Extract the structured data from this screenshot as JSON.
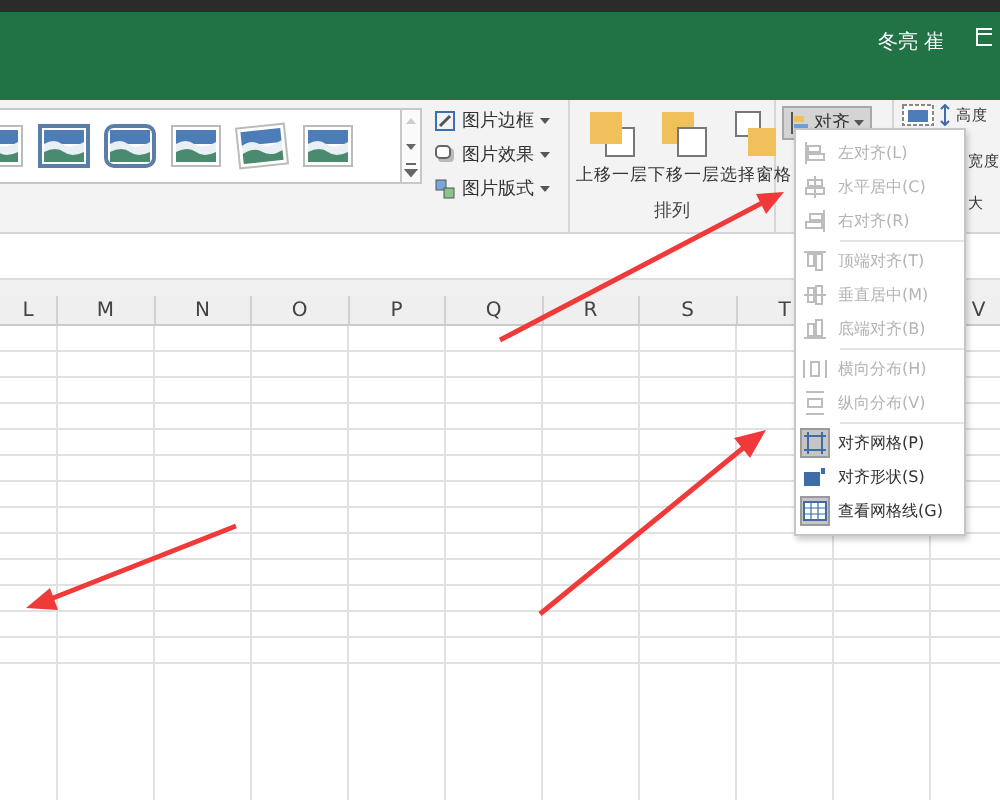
{
  "account": {
    "user_name": "冬亮 崔"
  },
  "ribbon": {
    "picture_commands": [
      {
        "label": "图片边框"
      },
      {
        "label": "图片效果"
      },
      {
        "label": "图片版式"
      }
    ],
    "arrange": {
      "buttons": [
        {
          "label": "上移一层",
          "kind": "forward"
        },
        {
          "label": "下移一层",
          "kind": "backward"
        },
        {
          "label": "选择窗格",
          "kind": "pane"
        }
      ],
      "align_button": {
        "label": "对齐",
        "expanded": true
      },
      "group_label": "排列"
    },
    "size": {
      "height_label": "高度",
      "width_label": "宽度",
      "group_label": "大"
    }
  },
  "align_menu": {
    "items": [
      {
        "label": "左对齐(L)",
        "kind": "left",
        "disabled": true,
        "checked": false
      },
      {
        "label": "水平居中(C)",
        "kind": "center",
        "disabled": true,
        "checked": false
      },
      {
        "label": "右对齐(R)",
        "kind": "right",
        "disabled": true,
        "checked": false,
        "separator_after": true
      },
      {
        "label": "顶端对齐(T)",
        "kind": "top",
        "disabled": true,
        "checked": false
      },
      {
        "label": "垂直居中(M)",
        "kind": "middle",
        "disabled": true,
        "checked": false
      },
      {
        "label": "底端对齐(B)",
        "kind": "bottom",
        "disabled": true,
        "checked": false,
        "separator_after": true
      },
      {
        "label": "横向分布(H)",
        "kind": "hdist",
        "disabled": true,
        "checked": false
      },
      {
        "label": "纵向分布(V)",
        "kind": "vdist",
        "disabled": true,
        "checked": false,
        "separator_after": true
      },
      {
        "label": "对齐网格(P)",
        "kind": "grid",
        "disabled": false,
        "checked": true
      },
      {
        "label": "对齐形状(S)",
        "kind": "shape",
        "disabled": false,
        "checked": false
      },
      {
        "label": "查看网格线(G)",
        "kind": "gridlines",
        "disabled": false,
        "checked": true
      }
    ]
  },
  "sheet": {
    "columns": [
      "L",
      "M",
      "N",
      "O",
      "P",
      "Q",
      "R",
      "S",
      "T",
      "V"
    ]
  }
}
